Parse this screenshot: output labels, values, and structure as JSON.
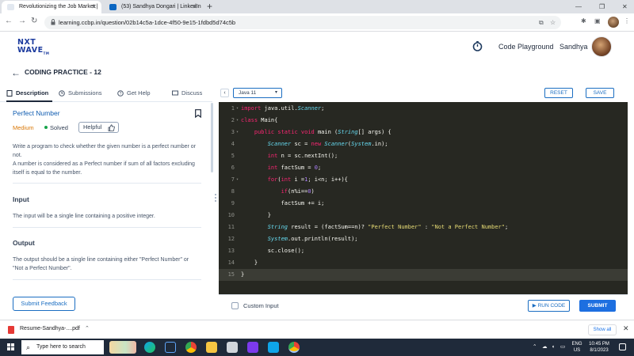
{
  "browser": {
    "tabs": [
      {
        "title": "Revolutionizing the Job Market |",
        "active": true
      },
      {
        "title": "(53) Sandhya Dongari | LinkedIn",
        "active": false
      }
    ],
    "url": "learning.ccbp.in/question/02b14c5a-1dce-4f50-9e15-1fdbd5d74c5b"
  },
  "site": {
    "logo_line1": "NXT",
    "logo_line2": "WAVE",
    "logo_tm": "TM",
    "code_playground": "Code Playground",
    "user_name": "Sandhya",
    "page_title": "CODING PRACTICE - 12"
  },
  "left_tabs": [
    "Description",
    "Submissions",
    "Get Help",
    "Discuss"
  ],
  "problem": {
    "title": "Perfect Number",
    "difficulty": "Medium",
    "status": "Solved",
    "helpful_label": "Helpful",
    "description": [
      "Write a program to check whether the given number is a perfect number or not.",
      "A number is considered as a Perfect number if sum of all factors excluding itself is equal to the number."
    ],
    "input_title": "Input",
    "input_text": "The input will be a single line containing a positive integer.",
    "output_title": "Output",
    "output_text": "The output should be a single line containing either \"Perfect Number\" or \"Not a Perfect Number\"."
  },
  "submit_feedback": "Submit Feedback",
  "editor": {
    "language": "Java 11",
    "reset": "RESET",
    "save": "SAVE",
    "custom_input": "Custom Input",
    "run_code": "RUN CODE",
    "submit": "SUBMIT",
    "theme_colors": {
      "background": "#272822",
      "keyword": "#f92672",
      "type": "#66d9ef",
      "string": "#e6db74",
      "number": "#ae81ff"
    },
    "code": [
      "import java.util.Scanner;",
      "class Main{",
      "    public static void main (String[] args) {",
      "        Scanner sc = new Scanner(System.in);",
      "        int n = sc.nextInt();",
      "        int factSum = 0;",
      "        for(int i =1; i<n; i++){",
      "            if(n%i==0)",
      "            factSum += i;",
      "        }",
      "        String result = (factSum==n)? \"Perfect Number\" : \"Not a Perfect Number\";",
      "        System.out.println(result);",
      "        sc.close();",
      "    }",
      "}"
    ],
    "current_line": 15
  },
  "downloads": {
    "file": "Resume-Sandhya-....pdf",
    "show_all": "Show all"
  },
  "taskbar": {
    "search_placeholder": "Type here to search",
    "lang_top": "ENG",
    "lang_bottom": "US",
    "time": "10:45 PM",
    "date": "8/1/2023"
  }
}
